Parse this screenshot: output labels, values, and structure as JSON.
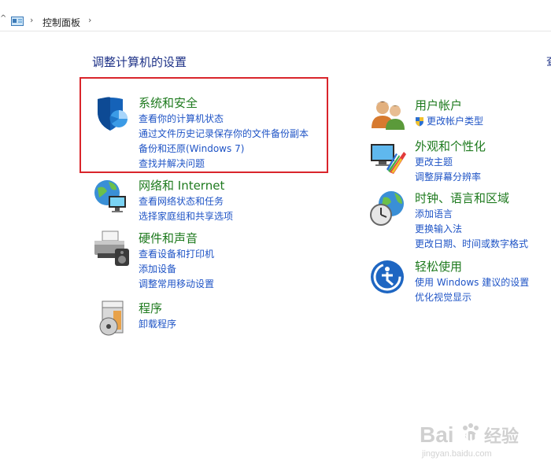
{
  "breadcrumb": {
    "root": "控制面板"
  },
  "heading": "调整计算机的设置",
  "view_fragment": "查",
  "left_categories": [
    {
      "title": "系统和安全",
      "links": [
        "查看你的计算机状态",
        "通过文件历史记录保存你的文件备份副本",
        "备份和还原(Windows 7)",
        "查找并解决问题"
      ]
    },
    {
      "title": "网络和 Internet",
      "links": [
        "查看网络状态和任务",
        "选择家庭组和共享选项"
      ]
    },
    {
      "title": "硬件和声音",
      "links": [
        "查看设备和打印机",
        "添加设备",
        "调整常用移动设置"
      ]
    },
    {
      "title": "程序",
      "links": [
        "卸载程序"
      ]
    }
  ],
  "right_categories": [
    {
      "title": "用户帐户",
      "links": [
        "更改帐户类型"
      ]
    },
    {
      "title": "外观和个性化",
      "links": [
        "更改主题",
        "调整屏幕分辨率"
      ]
    },
    {
      "title": "时钟、语言和区域",
      "links": [
        "添加语言",
        "更换输入法",
        "更改日期、时间或数字格式"
      ]
    },
    {
      "title": "轻松使用",
      "links": [
        "使用 Windows 建议的设置",
        "优化视觉显示"
      ]
    }
  ],
  "watermark": {
    "brand_left": "Bai",
    "brand_right": "du",
    "suffix": "经验",
    "site": "jingyan.baidu.com"
  },
  "colors": {
    "title_green": "#1e7a1e",
    "link_blue": "#1f54c6",
    "heading_blue": "#1e3287",
    "highlight_red": "#d9252b"
  }
}
